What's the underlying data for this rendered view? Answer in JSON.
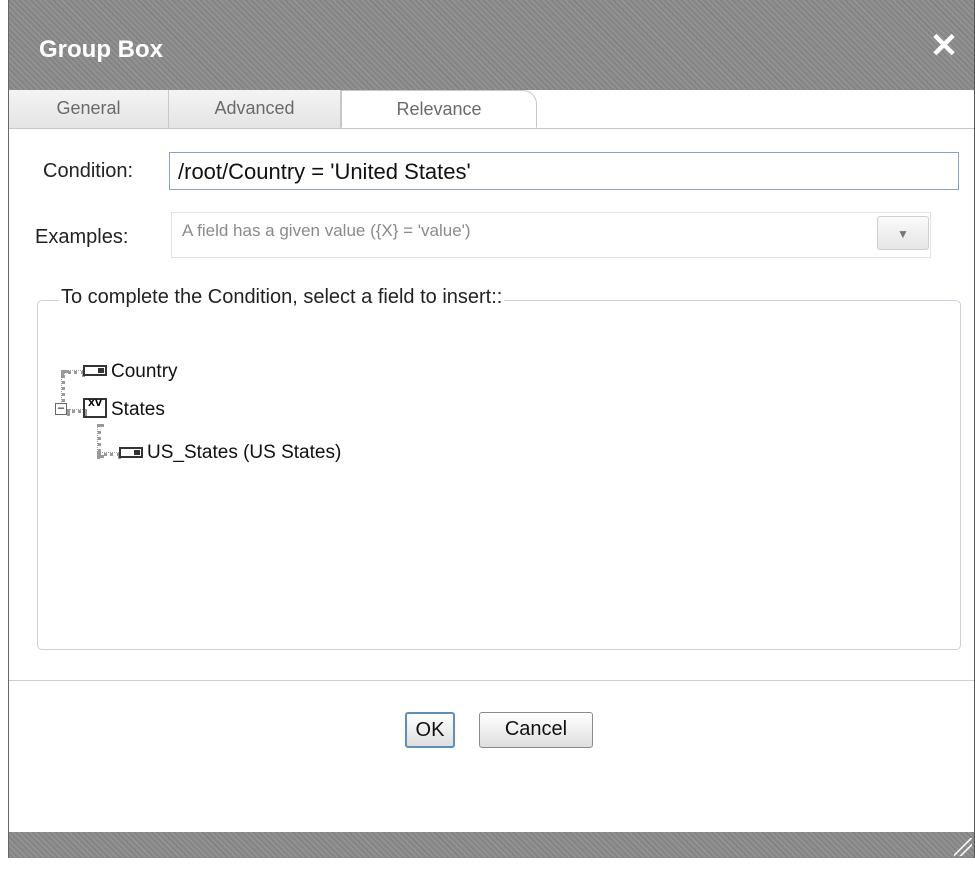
{
  "dialog": {
    "title": "Group Box",
    "close_icon": "close-icon"
  },
  "tabs": [
    {
      "label": "General",
      "active": false
    },
    {
      "label": "Advanced",
      "active": false
    },
    {
      "label": "Relevance",
      "active": true
    }
  ],
  "condition": {
    "label": "Condition:",
    "value": "/root/Country = 'United States'"
  },
  "examples": {
    "label": "Examples:",
    "selected": "A field has a given value ({X} = 'value')",
    "dropdown_icon": "chevron-down-icon"
  },
  "field_picker": {
    "legend": "To complete the Condition, select a field to insert::",
    "tree": [
      {
        "label": "Country",
        "icon": "text-field-icon"
      },
      {
        "label": "States",
        "icon": "group-icon",
        "expander": "−",
        "children": [
          {
            "label": "US_States (US States)",
            "icon": "text-field-icon"
          }
        ]
      }
    ],
    "group_icon_text": "XV"
  },
  "buttons": {
    "ok": "OK",
    "cancel": "Cancel"
  }
}
